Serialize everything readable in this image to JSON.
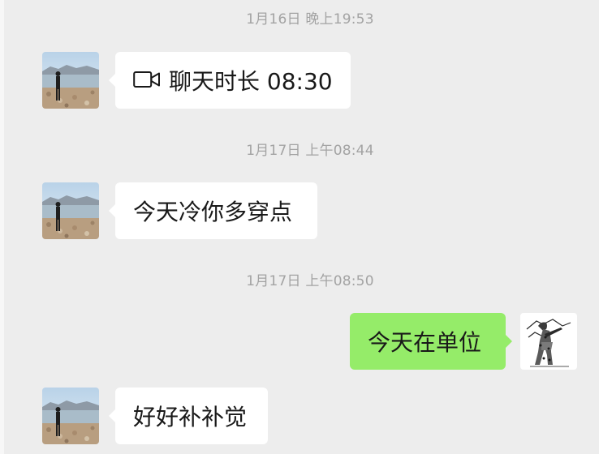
{
  "messages": [
    {
      "timestamp": "1月16日 晚上19:53",
      "sender": "contact",
      "type": "video-call",
      "icon": "video-call-icon",
      "text": "聊天时长 08:30"
    },
    {
      "timestamp": "1月17日 上午08:44",
      "sender": "contact",
      "type": "text",
      "text": "今天冷你多穿点"
    },
    {
      "timestamp": "1月17日 上午08:50",
      "sender": "me",
      "type": "text",
      "text": "今天在单位"
    },
    {
      "sender": "contact",
      "type": "text",
      "text": "好好补补觉"
    }
  ],
  "colors": {
    "background": "#EDEDED",
    "incoming_bubble": "#FFFFFF",
    "outgoing_bubble": "#95EC69",
    "timestamp_text": "#A3A3A3",
    "message_text": "#191919"
  }
}
